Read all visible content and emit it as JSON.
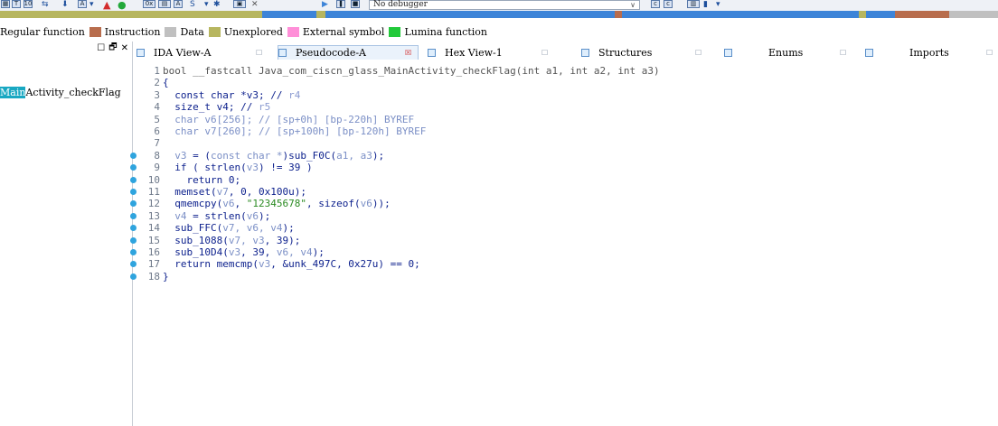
{
  "colors": {
    "regular_function": "#ffffff",
    "instruction": "#b86d4d",
    "data": "#c0c0c0",
    "unexplored": "#b7b65f",
    "external_symbol": "#ff8fd8",
    "lumina_function": "#22c93a",
    "nav_blue": "#3d84d8",
    "highlight_func": "#19a8c2"
  },
  "toolbar": {
    "debugger_label": "No debugger",
    "debugger_chevron": "∨"
  },
  "legend": {
    "items": [
      "Regular function",
      "Instruction",
      "Data",
      "Unexplored",
      "External symbol",
      "Lumina function"
    ]
  },
  "sidebar": {
    "controls": [
      "☐",
      "🗗",
      "✕"
    ],
    "function_highlight": "Main",
    "function_rest": "Activity_checkFlag"
  },
  "tabs": [
    {
      "label": "IDA View-A",
      "close": "☐",
      "active": false
    },
    {
      "label": "Pseudocode-A",
      "close": "☒",
      "active": true
    },
    {
      "label": "Hex View-1",
      "close": "☐",
      "active": false
    },
    {
      "label": "Structures",
      "close": "☐",
      "active": false
    },
    {
      "label": "Enums",
      "close": "☐",
      "active": false
    },
    {
      "label": "Imports",
      "close": "☐",
      "active": false
    }
  ],
  "code": [
    {
      "n": "1",
      "dot": false,
      "parts": [
        [
          "sig",
          "bool __fastcall Java_com_ciscn_glass_MainActivity_checkFlag(int a1, int a2, int a3)"
        ]
      ]
    },
    {
      "n": "2",
      "dot": false,
      "parts": [
        [
          "kw",
          "{"
        ]
      ]
    },
    {
      "n": "3",
      "dot": false,
      "parts": [
        [
          "kw",
          "  const char *v3; // "
        ],
        [
          "cmt",
          "r4"
        ]
      ]
    },
    {
      "n": "4",
      "dot": false,
      "parts": [
        [
          "kw",
          "  size_t v4; // "
        ],
        [
          "cmt",
          "r5"
        ]
      ]
    },
    {
      "n": "5",
      "dot": false,
      "parts": [
        [
          "var",
          "  char v6[256]; // [sp+0h] [bp-220h] BYREF"
        ]
      ]
    },
    {
      "n": "6",
      "dot": false,
      "parts": [
        [
          "var",
          "  char v7[260]; // [sp+100h] [bp-120h] BYREF"
        ]
      ]
    },
    {
      "n": "7",
      "dot": false,
      "parts": [
        [
          "kw",
          ""
        ]
      ]
    },
    {
      "n": "8",
      "dot": true,
      "parts": [
        [
          "var",
          "  v3"
        ],
        [
          "kw",
          " = ("
        ],
        [
          "var",
          "const char *"
        ],
        [
          "kw",
          ")sub_F0C("
        ],
        [
          "var",
          "a1, a3"
        ],
        [
          "kw",
          ");"
        ]
      ]
    },
    {
      "n": "9",
      "dot": true,
      "parts": [
        [
          "kw",
          "  if ( strlen("
        ],
        [
          "var",
          "v3"
        ],
        [
          "kw",
          ") != 39 )"
        ]
      ]
    },
    {
      "n": "10",
      "dot": true,
      "parts": [
        [
          "kw",
          "    return 0;"
        ]
      ]
    },
    {
      "n": "11",
      "dot": true,
      "parts": [
        [
          "kw",
          "  memset("
        ],
        [
          "var",
          "v7"
        ],
        [
          "kw",
          ", 0, 0x100u);"
        ]
      ]
    },
    {
      "n": "12",
      "dot": true,
      "parts": [
        [
          "kw",
          "  qmemcpy("
        ],
        [
          "var",
          "v6"
        ],
        [
          "kw",
          ", "
        ],
        [
          "str",
          "\"12345678\""
        ],
        [
          "kw",
          ", sizeof("
        ],
        [
          "var",
          "v6"
        ],
        [
          "kw",
          "));"
        ]
      ]
    },
    {
      "n": "13",
      "dot": true,
      "parts": [
        [
          "var",
          "  v4"
        ],
        [
          "kw",
          " = strlen("
        ],
        [
          "var",
          "v6"
        ],
        [
          "kw",
          ");"
        ]
      ]
    },
    {
      "n": "14",
      "dot": true,
      "parts": [
        [
          "kw",
          "  sub_FFC("
        ],
        [
          "var",
          "v7, v6, v4"
        ],
        [
          "kw",
          ");"
        ]
      ]
    },
    {
      "n": "15",
      "dot": true,
      "parts": [
        [
          "kw",
          "  sub_1088("
        ],
        [
          "var",
          "v7, v3"
        ],
        [
          "kw",
          ", 39);"
        ]
      ]
    },
    {
      "n": "16",
      "dot": true,
      "parts": [
        [
          "kw",
          "  sub_10D4("
        ],
        [
          "var",
          "v3"
        ],
        [
          "kw",
          ", 39, "
        ],
        [
          "var",
          "v6, v4"
        ],
        [
          "kw",
          ");"
        ]
      ]
    },
    {
      "n": "17",
      "dot": true,
      "parts": [
        [
          "kw",
          "  return memcmp("
        ],
        [
          "var",
          "v3"
        ],
        [
          "kw",
          ", &unk_497C, 0x27u) == 0;"
        ]
      ]
    },
    {
      "n": "18",
      "dot": true,
      "parts": [
        [
          "kw",
          "}"
        ]
      ]
    }
  ]
}
